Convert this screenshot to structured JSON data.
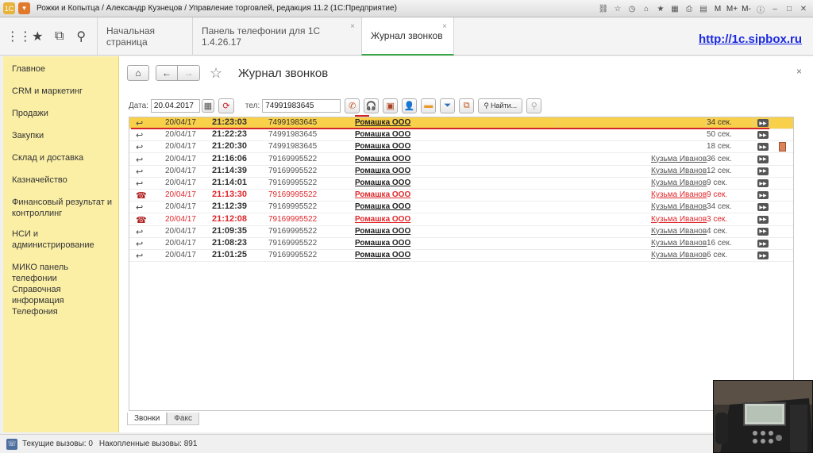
{
  "window": {
    "title": "Рожки и Копытца / Александр Кузнецов / Управление торговлей, редакция 11.2  (1С:Предприятие)",
    "right_icons": [
      "M",
      "M+",
      "M-"
    ]
  },
  "tabs": [
    {
      "label": "Начальная страница"
    },
    {
      "label": "Панель телефонии для 1С 1.4.26.17"
    },
    {
      "label": "Журнал звонков"
    }
  ],
  "sipbox_link": "http://1c.sipbox.ru",
  "sidebar": {
    "items": [
      "Главное",
      "CRM и маркетинг",
      "Продажи",
      "Закупки",
      "Склад и доставка",
      "Казначейство",
      "Финансовый результат и контроллинг",
      "НСИ и администрирование",
      "МИКО панель телефонии",
      "Справочная информация",
      "Телефония"
    ]
  },
  "form": {
    "title": "Журнал звонков",
    "date_label": "Дата:",
    "date_value": "20.04.2017",
    "phone_label": "тел:",
    "phone_value": "74991983645",
    "find_label": "Найти..."
  },
  "calls": [
    {
      "date": "20/04/17",
      "time": "21:23:03",
      "phone": "74991983645",
      "org": "Ромашка ООО",
      "agent": "",
      "duration": "34 сек.",
      "missed": false,
      "selected": true,
      "doc": false
    },
    {
      "date": "20/04/17",
      "time": "21:22:23",
      "phone": "74991983645",
      "org": "Ромашка ООО",
      "agent": "",
      "duration": "50 сек.",
      "missed": false,
      "selected": false,
      "doc": false
    },
    {
      "date": "20/04/17",
      "time": "21:20:30",
      "phone": "74991983645",
      "org": "Ромашка ООО",
      "agent": "",
      "duration": "18 сек.",
      "missed": false,
      "selected": false,
      "doc": true
    },
    {
      "date": "20/04/17",
      "time": "21:16:06",
      "phone": "79169995522",
      "org": "Ромашка ООО",
      "agent": "Кузьма Иванов",
      "duration": "36 сек.",
      "missed": false,
      "selected": false,
      "doc": false
    },
    {
      "date": "20/04/17",
      "time": "21:14:39",
      "phone": "79169995522",
      "org": "Ромашка ООО",
      "agent": "Кузьма Иванов",
      "duration": "12 сек.",
      "missed": false,
      "selected": false,
      "doc": false
    },
    {
      "date": "20/04/17",
      "time": "21:14:01",
      "phone": "79169995522",
      "org": "Ромашка ООО",
      "agent": "Кузьма Иванов",
      "duration": "9 сек.",
      "missed": false,
      "selected": false,
      "doc": false
    },
    {
      "date": "20/04/17",
      "time": "21:13:30",
      "phone": "79169995522",
      "org": "Ромашка ООО",
      "agent": "Кузьма Иванов",
      "duration": "9 сек.",
      "missed": true,
      "selected": false,
      "doc": false
    },
    {
      "date": "20/04/17",
      "time": "21:12:39",
      "phone": "79169995522",
      "org": "Ромашка ООО",
      "agent": "Кузьма Иванов",
      "duration": "34 сек.",
      "missed": false,
      "selected": false,
      "doc": false
    },
    {
      "date": "20/04/17",
      "time": "21:12:08",
      "phone": "79169995522",
      "org": "Ромашка ООО",
      "agent": "Кузьма Иванов",
      "duration": "3 сек.",
      "missed": true,
      "selected": false,
      "doc": false
    },
    {
      "date": "20/04/17",
      "time": "21:09:35",
      "phone": "79169995522",
      "org": "Ромашка ООО",
      "agent": "Кузьма Иванов",
      "duration": "4 сек.",
      "missed": false,
      "selected": false,
      "doc": false
    },
    {
      "date": "20/04/17",
      "time": "21:08:23",
      "phone": "79169995522",
      "org": "Ромашка ООО",
      "agent": "Кузьма Иванов",
      "duration": "16 сек.",
      "missed": false,
      "selected": false,
      "doc": false
    },
    {
      "date": "20/04/17",
      "time": "21:01:25",
      "phone": "79169995522",
      "org": "Ромашка ООО",
      "agent": "Кузьма Иванов",
      "duration": "6 сек.",
      "missed": false,
      "selected": false,
      "doc": false
    }
  ],
  "bottom_tabs": [
    "Звонки",
    "Факс"
  ],
  "status": {
    "current_calls": "Текущие вызовы: 0",
    "accumulated_calls": "Накопленные вызовы: 891"
  },
  "colors": {
    "sidebar_bg": "#fbefa6",
    "selected_row": "#f9d04a",
    "missed_text": "#e0262a",
    "link_blue": "#1a29e0",
    "accent_green": "#3aa64c"
  }
}
